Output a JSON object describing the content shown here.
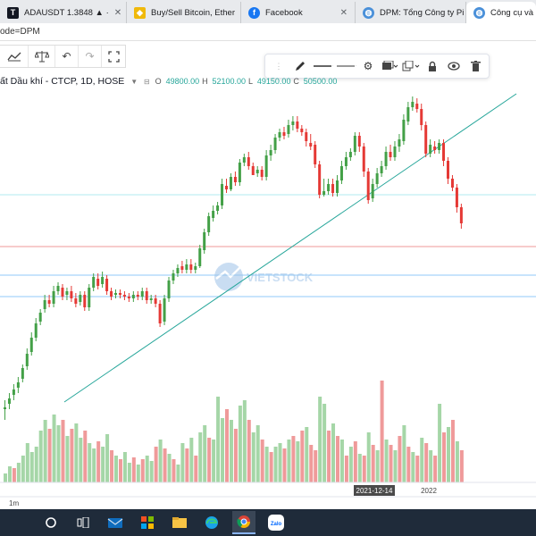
{
  "browser": {
    "tabs": [
      {
        "label": "ADAUSDT 1.3848 ▲ ·",
        "favicon": "tradingview-icon",
        "color": "#131722"
      },
      {
        "label": "Buy/Sell Bitcoin, Ether",
        "favicon": "binance-icon",
        "color": "#f0b90b"
      },
      {
        "label": "Facebook",
        "favicon": "facebook-icon",
        "color": "#1877f2"
      },
      {
        "label": "DPM: Tổng Công ty Pi",
        "favicon": "globe-icon",
        "color": "#4a90d9"
      },
      {
        "label": "Công cụ và Dữ",
        "favicon": "globe-icon",
        "color": "#4a90d9"
      }
    ]
  },
  "address_fragment": "ode=DPM",
  "legend": {
    "title": "ất Dầu khí - CTCP, 1D, HOSE",
    "o_label": "O",
    "o": "49800.00",
    "h_label": "H",
    "h": "52100.00",
    "l_label": "L",
    "l": "49150.00",
    "c_label": "C",
    "c": "50500.00"
  },
  "watermark": "VIETSTOCK",
  "chart": {
    "x_labels": [
      "2021-12-14",
      "2022"
    ],
    "timeframe": "1m",
    "up_color": "#43a047",
    "down_color": "#e53935",
    "vol_up_color": "#a5d6a7",
    "vol_down_color": "#ef9a9a",
    "trendline_color": "#26a69a",
    "hline_colors": [
      "#b2ebf2",
      "#ef9a9a",
      "#90caf9",
      "#90caf9"
    ]
  },
  "chart_data": {
    "type": "candlestick",
    "candles": [
      [
        458,
        456,
        470,
        448
      ],
      [
        452,
        446,
        458,
        440
      ],
      [
        442,
        436,
        448,
        430
      ],
      [
        434,
        428,
        440,
        422
      ],
      [
        424,
        412,
        428,
        408
      ],
      [
        410,
        396,
        414,
        390
      ],
      [
        394,
        378,
        398,
        372
      ],
      [
        378,
        362,
        382,
        356
      ],
      [
        360,
        350,
        364,
        346
      ],
      [
        346,
        336,
        350,
        330
      ],
      [
        336,
        340,
        344,
        330
      ],
      [
        340,
        326,
        344,
        320
      ],
      [
        326,
        320,
        330,
        316
      ],
      [
        322,
        332,
        336,
        318
      ],
      [
        330,
        326,
        336,
        322
      ],
      [
        326,
        334,
        338,
        320
      ],
      [
        334,
        340,
        344,
        328
      ],
      [
        338,
        330,
        342,
        326
      ],
      [
        330,
        344,
        348,
        326
      ],
      [
        344,
        322,
        348,
        318
      ],
      [
        322,
        310,
        326,
        306
      ],
      [
        312,
        320,
        324,
        306
      ],
      [
        318,
        310,
        322,
        304
      ],
      [
        312,
        326,
        330,
        308
      ],
      [
        326,
        332,
        336,
        322
      ],
      [
        330,
        328,
        334,
        324
      ],
      [
        328,
        330,
        334,
        324
      ],
      [
        330,
        332,
        336,
        326
      ],
      [
        332,
        334,
        338,
        328
      ],
      [
        334,
        330,
        338,
        326
      ],
      [
        330,
        332,
        336,
        326
      ],
      [
        332,
        326,
        336,
        322
      ],
      [
        326,
        336,
        340,
        322
      ],
      [
        336,
        334,
        340,
        330
      ],
      [
        334,
        340,
        344,
        330
      ],
      [
        340,
        362,
        366,
        336
      ],
      [
        360,
        334,
        364,
        330
      ],
      [
        334,
        314,
        338,
        310
      ],
      [
        314,
        306,
        318,
        302
      ],
      [
        306,
        300,
        310,
        296
      ],
      [
        298,
        302,
        306,
        292
      ],
      [
        302,
        296,
        306,
        290
      ],
      [
        296,
        302,
        306,
        290
      ],
      [
        302,
        298,
        306,
        294
      ],
      [
        298,
        278,
        300,
        274
      ],
      [
        280,
        260,
        284,
        256
      ],
      [
        260,
        242,
        264,
        238
      ],
      [
        244,
        236,
        248,
        230
      ],
      [
        236,
        230,
        240,
        226
      ],
      [
        230,
        206,
        234,
        200
      ],
      [
        208,
        212,
        216,
        200
      ],
      [
        212,
        198,
        214,
        194
      ],
      [
        198,
        204,
        208,
        192
      ],
      [
        204,
        182,
        208,
        178
      ],
      [
        182,
        176,
        186,
        172
      ],
      [
        176,
        186,
        190,
        170
      ],
      [
        186,
        196,
        196,
        182
      ],
      [
        194,
        190,
        198,
        186
      ],
      [
        190,
        198,
        202,
        186
      ],
      [
        198,
        174,
        202,
        168
      ],
      [
        174,
        168,
        180,
        162
      ],
      [
        168,
        154,
        172,
        150
      ],
      [
        154,
        148,
        158,
        144
      ],
      [
        148,
        152,
        156,
        142
      ],
      [
        150,
        140,
        154,
        134
      ],
      [
        140,
        136,
        146,
        130
      ],
      [
        136,
        144,
        148,
        130
      ],
      [
        144,
        148,
        152,
        140
      ],
      [
        148,
        158,
        164,
        144
      ],
      [
        160,
        164,
        168,
        150
      ],
      [
        162,
        184,
        188,
        158
      ],
      [
        184,
        218,
        222,
        180
      ],
      [
        218,
        214,
        220,
        200
      ],
      [
        214,
        206,
        218,
        200
      ],
      [
        206,
        216,
        220,
        200
      ],
      [
        216,
        202,
        220,
        196
      ],
      [
        202,
        186,
        206,
        180
      ],
      [
        186,
        176,
        190,
        170
      ],
      [
        176,
        170,
        180,
        166
      ],
      [
        170,
        152,
        174,
        148
      ],
      [
        152,
        164,
        170,
        148
      ],
      [
        164,
        192,
        198,
        160
      ],
      [
        192,
        224,
        228,
        188
      ],
      [
        222,
        206,
        226,
        200
      ],
      [
        206,
        194,
        210,
        188
      ],
      [
        194,
        186,
        198,
        180
      ],
      [
        186,
        170,
        190,
        164
      ],
      [
        170,
        176,
        180,
        162
      ],
      [
        176,
        164,
        180,
        158
      ],
      [
        164,
        156,
        170,
        150
      ],
      [
        158,
        134,
        162,
        128
      ],
      [
        136,
        120,
        140,
        114
      ],
      [
        120,
        114,
        124,
        108
      ],
      [
        116,
        122,
        126,
        110
      ],
      [
        122,
        140,
        146,
        116
      ],
      [
        140,
        172,
        176,
        136
      ],
      [
        172,
        162,
        176,
        156
      ],
      [
        164,
        168,
        172,
        158
      ],
      [
        168,
        160,
        172,
        156
      ],
      [
        160,
        180,
        186,
        156
      ],
      [
        180,
        200,
        206,
        176
      ],
      [
        200,
        210,
        214,
        196
      ],
      [
        210,
        232,
        238,
        206
      ],
      [
        232,
        250,
        256,
        228
      ]
    ],
    "volumes": [
      [
        10,
        1
      ],
      [
        18,
        1
      ],
      [
        16,
        0
      ],
      [
        22,
        1
      ],
      [
        30,
        1
      ],
      [
        44,
        1
      ],
      [
        34,
        1
      ],
      [
        40,
        1
      ],
      [
        58,
        1
      ],
      [
        70,
        1
      ],
      [
        60,
        0
      ],
      [
        76,
        1
      ],
      [
        64,
        1
      ],
      [
        70,
        0
      ],
      [
        52,
        1
      ],
      [
        60,
        0
      ],
      [
        66,
        1
      ],
      [
        50,
        1
      ],
      [
        58,
        0
      ],
      [
        44,
        1
      ],
      [
        38,
        1
      ],
      [
        46,
        0
      ],
      [
        40,
        1
      ],
      [
        54,
        1
      ],
      [
        36,
        0
      ],
      [
        30,
        1
      ],
      [
        26,
        0
      ],
      [
        34,
        1
      ],
      [
        22,
        1
      ],
      [
        28,
        0
      ],
      [
        20,
        1
      ],
      [
        26,
        0
      ],
      [
        30,
        1
      ],
      [
        24,
        1
      ],
      [
        40,
        0
      ],
      [
        48,
        1
      ],
      [
        38,
        0
      ],
      [
        32,
        1
      ],
      [
        26,
        0
      ],
      [
        20,
        1
      ],
      [
        44,
        1
      ],
      [
        38,
        0
      ],
      [
        50,
        1
      ],
      [
        30,
        0
      ],
      [
        56,
        1
      ],
      [
        64,
        1
      ],
      [
        50,
        0
      ],
      [
        48,
        1
      ],
      [
        96,
        1
      ],
      [
        72,
        1
      ],
      [
        82,
        0
      ],
      [
        70,
        1
      ],
      [
        60,
        0
      ],
      [
        86,
        1
      ],
      [
        92,
        1
      ],
      [
        70,
        0
      ],
      [
        56,
        1
      ],
      [
        64,
        1
      ],
      [
        48,
        0
      ],
      [
        40,
        1
      ],
      [
        34,
        0
      ],
      [
        40,
        1
      ],
      [
        44,
        1
      ],
      [
        38,
        0
      ],
      [
        48,
        1
      ],
      [
        52,
        0
      ],
      [
        46,
        1
      ],
      [
        58,
        0
      ],
      [
        62,
        1
      ],
      [
        42,
        0
      ],
      [
        36,
        0
      ],
      [
        96,
        1
      ],
      [
        88,
        1
      ],
      [
        58,
        0
      ],
      [
        66,
        1
      ],
      [
        52,
        0
      ],
      [
        48,
        1
      ],
      [
        30,
        0
      ],
      [
        40,
        1
      ],
      [
        46,
        0
      ],
      [
        32,
        1
      ],
      [
        30,
        0
      ],
      [
        56,
        1
      ],
      [
        42,
        0
      ],
      [
        36,
        1
      ],
      [
        114,
        0
      ],
      [
        48,
        1
      ],
      [
        42,
        0
      ],
      [
        36,
        1
      ],
      [
        52,
        0
      ],
      [
        64,
        1
      ],
      [
        40,
        0
      ],
      [
        34,
        1
      ],
      [
        30,
        0
      ],
      [
        50,
        1
      ],
      [
        44,
        0
      ],
      [
        36,
        1
      ],
      [
        30,
        0
      ],
      [
        88,
        1
      ],
      [
        56,
        0
      ],
      [
        62,
        1
      ],
      [
        70,
        0
      ],
      [
        46,
        1
      ],
      [
        36,
        0
      ]
    ]
  }
}
